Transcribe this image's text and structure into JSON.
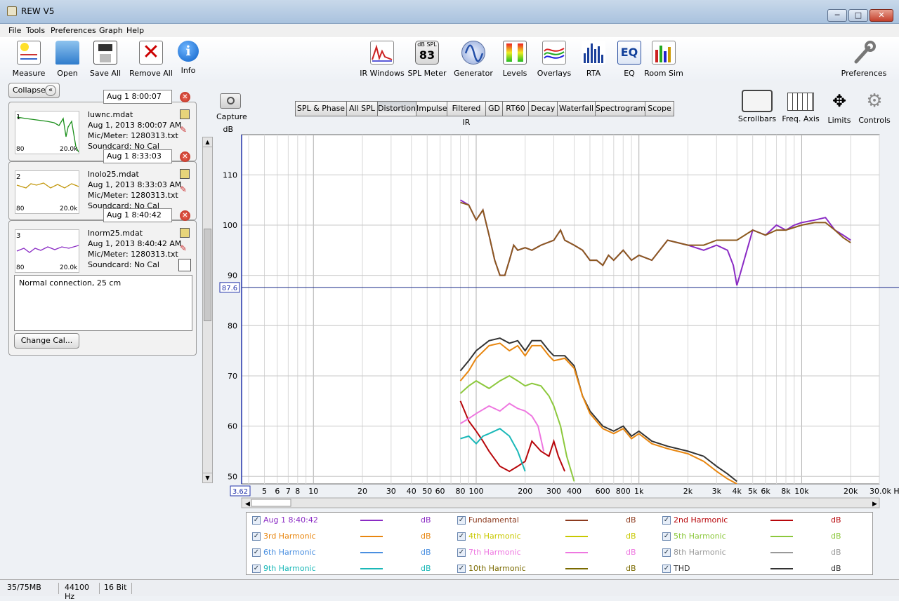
{
  "window": {
    "title": "REW V5"
  },
  "menu": [
    "File",
    "Tools",
    "Preferences",
    "Graph",
    "Help"
  ],
  "toolbar_left": [
    {
      "label": "Measure",
      "icon": "measure-icon"
    },
    {
      "label": "Open",
      "icon": "folder-icon"
    },
    {
      "label": "Save All",
      "icon": "save-all-icon"
    },
    {
      "label": "Remove All",
      "icon": "remove-all-icon"
    },
    {
      "label": "Info",
      "icon": "info-icon"
    }
  ],
  "toolbar_center": [
    {
      "label": "IR Windows",
      "icon": "ir-windows-icon"
    },
    {
      "label": "SPL Meter",
      "icon": "spl-meter-icon",
      "badge_top": "dB SPL",
      "badge_value": "83"
    },
    {
      "label": "Generator",
      "icon": "generator-icon"
    },
    {
      "label": "Levels",
      "icon": "levels-icon"
    },
    {
      "label": "Overlays",
      "icon": "overlays-icon"
    },
    {
      "label": "RTA",
      "icon": "rta-icon"
    },
    {
      "label": "EQ",
      "icon": "eq-icon",
      "badge_value": "EQ"
    },
    {
      "label": "Room Sim",
      "icon": "room-sim-icon"
    }
  ],
  "toolbar_right": {
    "label": "Preferences",
    "icon": "wrench-icon"
  },
  "left_panel": {
    "collapse_label": "Collapse",
    "measurements": [
      {
        "number": "1",
        "date": "Aug 1 8:00:07",
        "name": "luwnc.mdat",
        "timestamp": "Aug 1, 2013 8:00:07 AM",
        "mic": "Mic/Meter: 1280313.txt",
        "soundcard": "Soundcard: No Cal",
        "thumb_color": "#1a8f1a",
        "thumb_lo": "80",
        "thumb_hi": "20.0k"
      },
      {
        "number": "2",
        "date": "Aug 1 8:33:03",
        "name": "lnolo25.mdat",
        "timestamp": "Aug 1, 2013 8:33:03 AM",
        "mic": "Mic/Meter: 1280313.txt",
        "soundcard": "Soundcard: No Cal",
        "thumb_color": "#c49a12",
        "thumb_lo": "80",
        "thumb_hi": "20.0k"
      },
      {
        "number": "3",
        "date": "Aug 1 8:40:42",
        "name": "lnorm25.mdat",
        "timestamp": "Aug 1, 2013 8:40:42 AM",
        "mic": "Mic/Meter: 1280313.txt",
        "soundcard": "Soundcard: No Cal",
        "thumb_color": "#8a2bc4",
        "thumb_lo": "80",
        "thumb_hi": "20.0k"
      }
    ],
    "notes": "Normal connection, 25 cm",
    "change_cal_label": "Change Cal..."
  },
  "capture_label": "Capture",
  "graph_tabs": [
    "SPL & Phase",
    "All SPL",
    "Distortion",
    "Impulse",
    "Filtered IR",
    "GD",
    "RT60",
    "Decay",
    "Waterfall",
    "Spectrogram",
    "Scope"
  ],
  "active_tab": "Distortion",
  "right_tools": [
    {
      "label": "Scrollbars",
      "icon": "scrollbars-icon"
    },
    {
      "label": "Freq. Axis",
      "icon": "freq-axis-icon"
    },
    {
      "label": "Limits",
      "icon": "limits-icon"
    },
    {
      "label": "Controls",
      "icon": "gear-icon"
    }
  ],
  "chart_data": {
    "type": "line",
    "ylabel": "dB",
    "xunit": "Hz",
    "x_scale": "log",
    "xlim": [
      3.62,
      30000
    ],
    "ylim": [
      48.5,
      118
    ],
    "y_ticks": [
      50,
      60,
      70,
      80,
      90,
      100,
      110
    ],
    "x_tick_labels": [
      "5",
      "6",
      "7",
      "8",
      "10",
      "20",
      "30",
      "40",
      "50",
      "60",
      "80",
      "100",
      "200",
      "300",
      "400",
      "600",
      "800",
      "1k",
      "2k",
      "3k",
      "4k",
      "5k",
      "6k",
      "8k",
      "10k",
      "20k",
      "30.0k Hz"
    ],
    "x_tick_values": [
      5,
      6,
      7,
      8,
      10,
      20,
      30,
      40,
      50,
      60,
      80,
      100,
      200,
      300,
      400,
      600,
      800,
      1000,
      2000,
      3000,
      4000,
      5000,
      6000,
      8000,
      10000,
      20000,
      30000
    ],
    "x_axis_start_label": "3.62",
    "cursor_value": "87.6",
    "cursor_y": 87.6,
    "grid": true,
    "series": [
      {
        "name": "Aug 1 8:40:42",
        "color": "#8a2bc4",
        "x": [
          80,
          90,
          100,
          110,
          120,
          130,
          140,
          150,
          160,
          170,
          180,
          200,
          220,
          250,
          300,
          330,
          350,
          400,
          450,
          500,
          550,
          600,
          650,
          700,
          800,
          900,
          1000,
          1200,
          1500,
          2000,
          2500,
          3000,
          3500,
          3800,
          4000,
          5000,
          6000,
          7000,
          8000,
          9000,
          10000,
          12000,
          14000,
          16000,
          18000,
          20000
        ],
        "y": [
          105,
          104,
          101,
          103,
          98,
          93,
          90,
          90,
          93,
          96,
          95,
          95.5,
          95,
          96,
          97,
          99,
          97,
          96,
          95,
          93,
          93,
          92,
          94,
          93,
          95,
          93,
          94,
          93,
          97,
          96,
          95,
          96,
          95,
          92,
          88,
          99,
          98,
          100,
          99,
          100,
          100.5,
          101,
          101.5,
          99,
          98,
          97
        ]
      },
      {
        "name": "Fundamental",
        "color": "#8c5a1e",
        "x": [
          80,
          90,
          100,
          110,
          120,
          130,
          140,
          150,
          160,
          170,
          180,
          200,
          220,
          250,
          300,
          330,
          350,
          400,
          450,
          500,
          550,
          600,
          650,
          700,
          800,
          900,
          1000,
          1200,
          1500,
          2000,
          2500,
          3000,
          3500,
          4000,
          5000,
          6000,
          7000,
          8000,
          10000,
          12000,
          14000,
          16000,
          18000,
          20000
        ],
        "y": [
          104.5,
          104,
          101,
          103,
          98,
          93,
          90,
          90,
          93,
          96,
          95,
          95.5,
          95,
          96,
          97,
          99,
          97,
          96,
          95,
          93,
          93,
          92,
          94,
          93,
          95,
          93,
          94,
          93,
          97,
          96,
          96,
          97,
          97,
          97,
          99,
          98,
          99,
          99,
          100,
          100.5,
          100.5,
          99,
          97.5,
          96.5
        ]
      },
      {
        "name": "THD",
        "color": "#333333",
        "x": [
          80,
          90,
          100,
          120,
          140,
          160,
          180,
          200,
          220,
          250,
          280,
          300,
          350,
          400,
          450,
          500,
          600,
          700,
          800,
          900,
          1000,
          1200,
          1500,
          2000,
          2500,
          3000,
          3500,
          4000
        ],
        "y": [
          71,
          73,
          75,
          77,
          77.5,
          76.5,
          77,
          75,
          77,
          77,
          75,
          74,
          74,
          72,
          66,
          63,
          60,
          59,
          60,
          58,
          59,
          57,
          56,
          55,
          54,
          52,
          50.5,
          49
        ]
      },
      {
        "name": "2nd Harmonic",
        "color": "#b8070b",
        "x": [
          80,
          90,
          100,
          110,
          120,
          140,
          160,
          180,
          200,
          220,
          250,
          280,
          300,
          320,
          350
        ],
        "y": [
          65,
          61,
          59,
          57,
          55,
          52,
          51,
          52,
          53,
          57,
          55,
          54,
          57,
          54,
          51
        ]
      },
      {
        "name": "3rd Harmonic",
        "color": "#e8860f",
        "x": [
          80,
          90,
          100,
          120,
          140,
          160,
          180,
          200,
          220,
          250,
          280,
          300,
          350,
          400,
          450,
          500,
          600,
          700,
          800,
          900,
          1000,
          1200,
          1500,
          2000,
          2500,
          3000,
          3500,
          4000
        ],
        "y": [
          69,
          71,
          73.5,
          76,
          76.5,
          75,
          76,
          74,
          76,
          76,
          74,
          73,
          73.5,
          71.5,
          66,
          62.5,
          59.5,
          58.5,
          59.5,
          57.5,
          58.5,
          56.5,
          55.5,
          54.5,
          53,
          51,
          49.5,
          48.5
        ]
      },
      {
        "name": "4th Harmonic",
        "color": "#c8c800",
        "x": [],
        "y": []
      },
      {
        "name": "5th Harmonic",
        "color": "#8cc83c",
        "x": [
          80,
          90,
          100,
          120,
          140,
          160,
          180,
          200,
          220,
          250,
          280,
          300,
          330,
          360,
          400
        ],
        "y": [
          66.5,
          68,
          69,
          67.5,
          69,
          70,
          69,
          68,
          68.5,
          68,
          66,
          64,
          60,
          54,
          49
        ]
      },
      {
        "name": "6th Harmonic",
        "color": "#4a8fe0",
        "x": [],
        "y": []
      },
      {
        "name": "7th Harmonic",
        "color": "#ee77e0",
        "x": [
          80,
          90,
          100,
          120,
          140,
          160,
          180,
          200,
          220,
          240,
          260
        ],
        "y": [
          60.5,
          61.5,
          62.5,
          64,
          63,
          64.5,
          63.5,
          63,
          62,
          60,
          55
        ]
      },
      {
        "name": "8th Harmonic",
        "color": "#999999",
        "x": [],
        "y": []
      },
      {
        "name": "9th Harmonic",
        "color": "#1ab8b8",
        "x": [
          80,
          90,
          100,
          110,
          120,
          140,
          160,
          180,
          200
        ],
        "y": [
          57.5,
          58,
          56.5,
          58,
          58.5,
          59.5,
          58,
          55,
          51
        ]
      },
      {
        "name": "10th Harmonic",
        "color": "#7a6a00",
        "x": [],
        "y": []
      }
    ]
  },
  "legend": [
    {
      "label": "Aug 1 8:40:42",
      "color": "#8a2bc4",
      "unit": "dB"
    },
    {
      "label": "Fundamental",
      "color": "#8c3a1e",
      "unit": "dB"
    },
    {
      "label": "2nd Harmonic",
      "color": "#b8070b",
      "unit": "dB"
    },
    {
      "label": "3rd Harmonic",
      "color": "#e8860f",
      "unit": "dB"
    },
    {
      "label": "4th Harmonic",
      "color": "#c8c800",
      "unit": "dB"
    },
    {
      "label": "5th Harmonic",
      "color": "#8cc83c",
      "unit": "dB"
    },
    {
      "label": "6th Harmonic",
      "color": "#4a8fe0",
      "unit": "dB"
    },
    {
      "label": "7th Harmonic",
      "color": "#ee77e0",
      "unit": "dB"
    },
    {
      "label": "8th Harmonic",
      "color": "#999999",
      "unit": "dB"
    },
    {
      "label": "9th Harmonic",
      "color": "#1ab8b8",
      "unit": "dB"
    },
    {
      "label": "10th Harmonic",
      "color": "#7a6a00",
      "unit": "dB"
    },
    {
      "label": "THD",
      "color": "#333333",
      "unit": "dB"
    }
  ],
  "status": [
    "35/75MB",
    "44100 Hz",
    "16 Bit"
  ]
}
